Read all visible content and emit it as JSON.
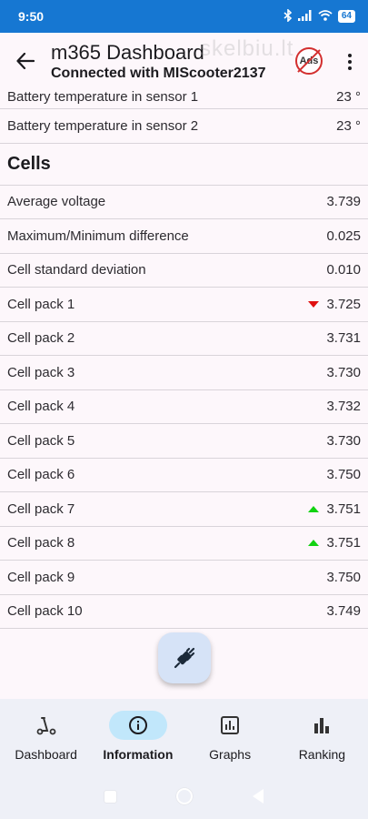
{
  "status_bar": {
    "time": "9:50",
    "battery": "64",
    "icons": [
      "bluetooth-icon",
      "signal-icon",
      "wifi-icon",
      "battery-icon"
    ]
  },
  "app_bar": {
    "title": "m365 Dashboard",
    "subtitle": "Connected with MIScooter2137",
    "watermark": "skelbiu.lt",
    "ads_label": "Ads"
  },
  "battery_rows": [
    {
      "label": "Battery temperature in sensor 1",
      "value": "23 °"
    },
    {
      "label": "Battery temperature in sensor 2",
      "value": "23 °"
    }
  ],
  "cells": {
    "heading": "Cells",
    "rows": [
      {
        "label": "Average voltage",
        "value": "3.739",
        "indicator": "none"
      },
      {
        "label": "Maximum/Minimum difference",
        "value": "0.025",
        "indicator": "none"
      },
      {
        "label": "Cell standard deviation",
        "value": "0.010",
        "indicator": "none"
      },
      {
        "label": "Cell pack 1",
        "value": "3.725",
        "indicator": "down"
      },
      {
        "label": "Cell pack 2",
        "value": "3.731",
        "indicator": "none"
      },
      {
        "label": "Cell pack 3",
        "value": "3.730",
        "indicator": "none"
      },
      {
        "label": "Cell pack 4",
        "value": "3.732",
        "indicator": "none"
      },
      {
        "label": "Cell pack 5",
        "value": "3.730",
        "indicator": "none"
      },
      {
        "label": "Cell pack 6",
        "value": "3.750",
        "indicator": "none"
      },
      {
        "label": "Cell pack 7",
        "value": "3.751",
        "indicator": "up"
      },
      {
        "label": "Cell pack 8",
        "value": "3.751",
        "indicator": "up"
      },
      {
        "label": "Cell pack 9",
        "value": "3.750",
        "indicator": "none"
      },
      {
        "label": "Cell pack 10",
        "value": "3.749",
        "indicator": "none"
      }
    ]
  },
  "fab": {
    "icon": "plug-disconnect-icon"
  },
  "bottom_nav": [
    {
      "label": "Dashboard",
      "icon": "scooter-icon",
      "active": false
    },
    {
      "label": "Information",
      "icon": "info-icon",
      "active": true
    },
    {
      "label": "Graphs",
      "icon": "graph-icon",
      "active": false
    },
    {
      "label": "Ranking",
      "icon": "bar-chart-icon",
      "active": false
    }
  ],
  "colors": {
    "status_bar": "#1677d2",
    "indicator_down": "#e01010",
    "indicator_up": "#12d212",
    "nav_active_pill": "#c1e7fb",
    "fab": "#d6e3f7"
  }
}
